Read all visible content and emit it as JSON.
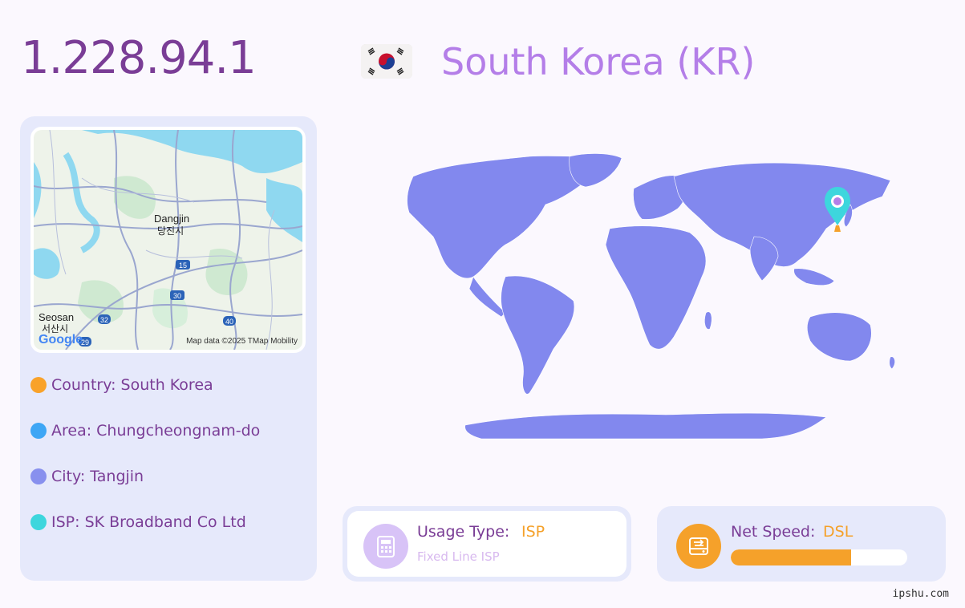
{
  "header": {
    "ip": "1.228.94.1",
    "country_title": "South Korea (KR)",
    "flag_icon": "south-korea-flag-icon"
  },
  "map": {
    "labels": {
      "city_en": "Dangjin",
      "city_ko": "당진시",
      "city2_en": "Seosan",
      "city2_ko": "서산시",
      "route_15": "15",
      "route_30": "30",
      "route_32": "32",
      "route_40": "40",
      "route_29": "29"
    },
    "google": "Google",
    "copyright": "Map data ©2025 TMap Mobility"
  },
  "info": {
    "country": "Country: South Korea",
    "area": "Area: Chungcheongnam-do",
    "city": "City: Tangjin",
    "isp": "ISP: SK Broadband Co Ltd",
    "colors": {
      "country": "#f9a22a",
      "area": "#3ea6f5",
      "city": "#8890ee",
      "isp": "#3dd6dd"
    }
  },
  "usage": {
    "label": "Usage Type:",
    "value": "ISP",
    "sub": "Fixed Line ISP",
    "icon": "fax-phone-icon"
  },
  "speed": {
    "label": "Net Speed:",
    "value": "DSL",
    "progress": 0.68,
    "icon": "network-drive-icon"
  },
  "footer": {
    "site": "ipshu.com"
  },
  "colors": {
    "accent_purple": "#7a3d96",
    "light_purple": "#b47ee8",
    "card_bg": "#e6e9fb",
    "map_land": "#8288ee",
    "pin": "#3dd6dd",
    "orange": "#f5a12a"
  }
}
